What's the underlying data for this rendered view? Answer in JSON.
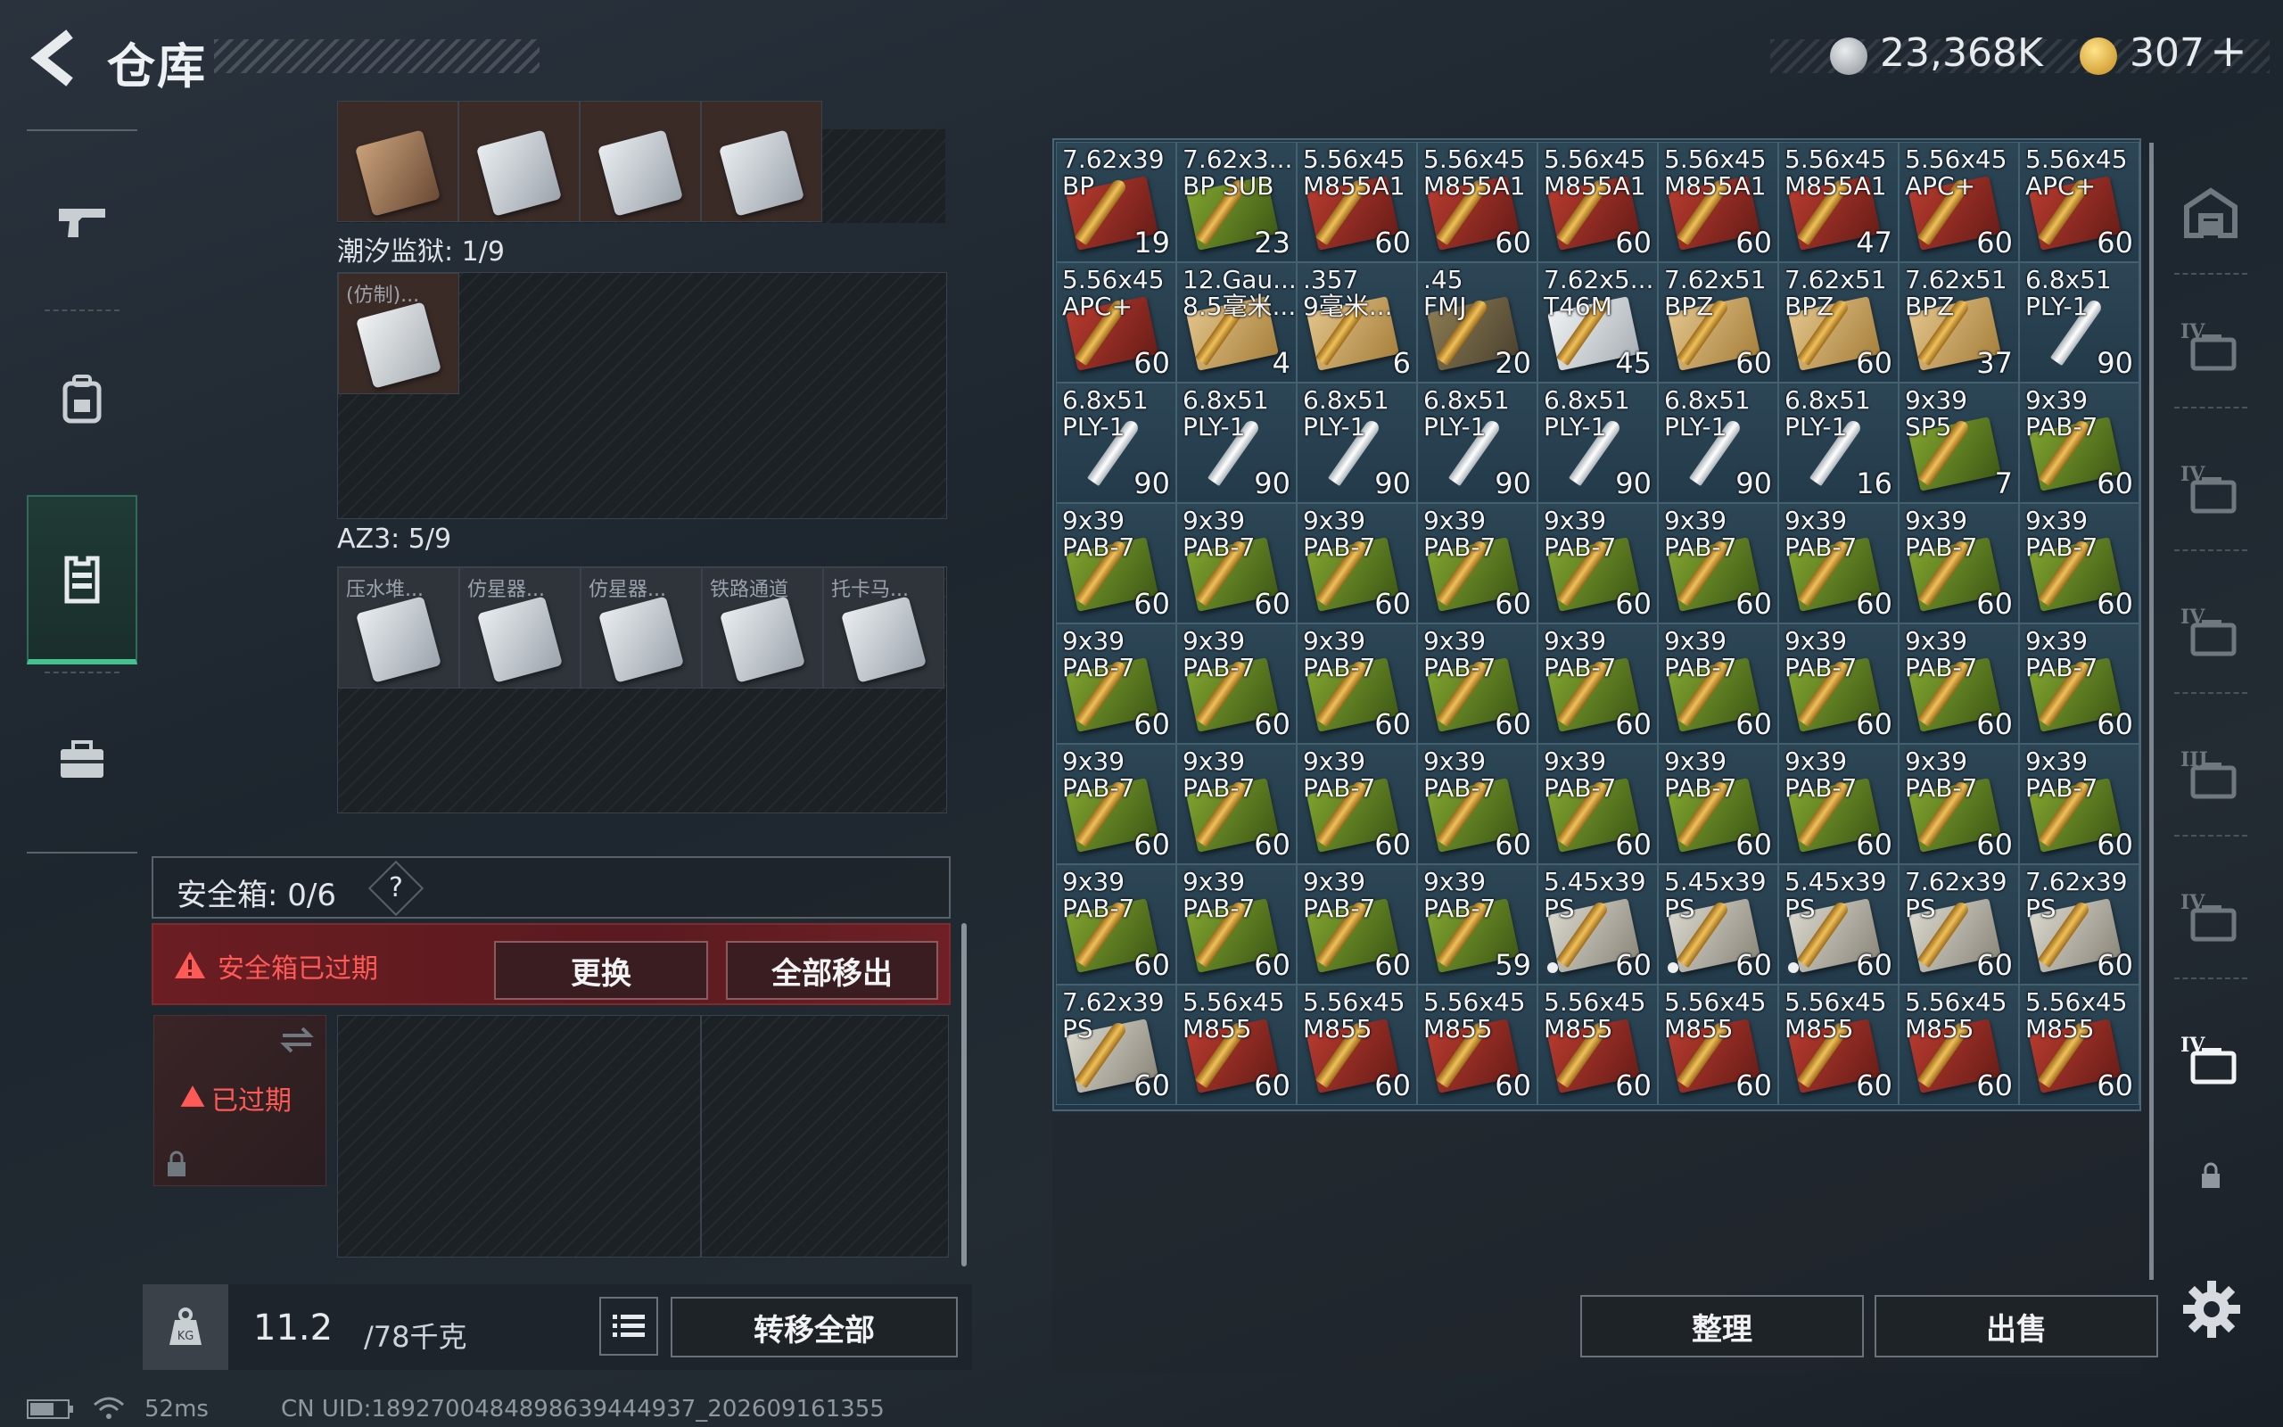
{
  "header": {
    "title": "仓库",
    "silver_amount": "23,368K",
    "gold_amount": "307",
    "plus_label": "+"
  },
  "left_nav": [
    "gun-icon",
    "backpack-icon",
    "armor-vest-icon",
    "toolbox-icon"
  ],
  "containers": [
    {
      "label": "潮汐监狱: 1/9",
      "items": [
        "(仿制)..."
      ]
    },
    {
      "label": "AZ3: 5/9",
      "items": [
        "压水堆...",
        "仿星器...",
        "仿星器...",
        "铁路通道",
        "托卡马..."
      ]
    }
  ],
  "safe_box": {
    "label": "安全箱: 0/6",
    "help": "?",
    "expired_text": "安全箱已过期",
    "replace_label": "更换",
    "move_all_label": "全部移出",
    "case_status": "已过期"
  },
  "footer": {
    "weight_current": "11.2",
    "weight_max": "/78千克",
    "transfer_label": "转移全部",
    "sort_label": "整理",
    "sell_label": "出售"
  },
  "stash": {
    "rows": [
      [
        {
          "name": "7.62x39\nBP",
          "count": "19",
          "kind": "red"
        },
        {
          "name": "7.62x3...\nBP SUB",
          "count": "23",
          "kind": "green"
        },
        {
          "name": "5.56x45\nM855A1",
          "count": "60",
          "kind": "red"
        },
        {
          "name": "5.56x45\nM855A1",
          "count": "60",
          "kind": "red"
        },
        {
          "name": "5.56x45\nM855A1",
          "count": "60",
          "kind": "red"
        },
        {
          "name": "5.56x45\nM855A1",
          "count": "60",
          "kind": "red"
        },
        {
          "name": "5.56x45\nM855A1",
          "count": "47",
          "kind": "red"
        },
        {
          "name": "5.56x45\nAPC+",
          "count": "60",
          "kind": "red"
        },
        {
          "name": "5.56x45\nAPC+",
          "count": "60",
          "kind": "red"
        }
      ],
      [
        {
          "name": "5.56x45\nAPC+",
          "count": "60",
          "kind": "red"
        },
        {
          "name": "12.Gau...\n8.5毫米...",
          "count": "4",
          "kind": "tan"
        },
        {
          "name": ".357\n9毫米...",
          "count": "6",
          "kind": "tan"
        },
        {
          "name": ".45\nFMJ",
          "count": "20",
          "kind": "olive"
        },
        {
          "name": "7.62x5...\nT46M",
          "count": "45",
          "kind": "white"
        },
        {
          "name": "7.62x51\nBPZ",
          "count": "60",
          "kind": "tan"
        },
        {
          "name": "7.62x51\nBPZ",
          "count": "60",
          "kind": "tan"
        },
        {
          "name": "7.62x51\nBPZ",
          "count": "37",
          "kind": "tan"
        },
        {
          "name": "6.8x51\nPLY-1",
          "count": "90",
          "kind": "none"
        }
      ],
      [
        {
          "name": "6.8x51\nPLY-1",
          "count": "90",
          "kind": "none"
        },
        {
          "name": "6.8x51\nPLY-1",
          "count": "90",
          "kind": "none"
        },
        {
          "name": "6.8x51\nPLY-1",
          "count": "90",
          "kind": "none"
        },
        {
          "name": "6.8x51\nPLY-1",
          "count": "90",
          "kind": "none"
        },
        {
          "name": "6.8x51\nPLY-1",
          "count": "90",
          "kind": "none"
        },
        {
          "name": "6.8x51\nPLY-1",
          "count": "90",
          "kind": "none"
        },
        {
          "name": "6.8x51\nPLY-1",
          "count": "16",
          "kind": "none"
        },
        {
          "name": "9x39\nSP5",
          "count": "7",
          "kind": "green"
        },
        {
          "name": "9x39\nPAB-7",
          "count": "60",
          "kind": "green"
        }
      ],
      [
        {
          "name": "9x39\nPAB-7",
          "count": "60",
          "kind": "green"
        },
        {
          "name": "9x39\nPAB-7",
          "count": "60",
          "kind": "green"
        },
        {
          "name": "9x39\nPAB-7",
          "count": "60",
          "kind": "green"
        },
        {
          "name": "9x39\nPAB-7",
          "count": "60",
          "kind": "green"
        },
        {
          "name": "9x39\nPAB-7",
          "count": "60",
          "kind": "green"
        },
        {
          "name": "9x39\nPAB-7",
          "count": "60",
          "kind": "green"
        },
        {
          "name": "9x39\nPAB-7",
          "count": "60",
          "kind": "green"
        },
        {
          "name": "9x39\nPAB-7",
          "count": "60",
          "kind": "green"
        },
        {
          "name": "9x39\nPAB-7",
          "count": "60",
          "kind": "green"
        }
      ],
      [
        {
          "name": "9x39\nPAB-7",
          "count": "60",
          "kind": "green"
        },
        {
          "name": "9x39\nPAB-7",
          "count": "60",
          "kind": "green"
        },
        {
          "name": "9x39\nPAB-7",
          "count": "60",
          "kind": "green"
        },
        {
          "name": "9x39\nPAB-7",
          "count": "60",
          "kind": "green"
        },
        {
          "name": "9x39\nPAB-7",
          "count": "60",
          "kind": "green"
        },
        {
          "name": "9x39\nPAB-7",
          "count": "60",
          "kind": "green"
        },
        {
          "name": "9x39\nPAB-7",
          "count": "60",
          "kind": "green"
        },
        {
          "name": "9x39\nPAB-7",
          "count": "60",
          "kind": "green"
        },
        {
          "name": "9x39\nPAB-7",
          "count": "60",
          "kind": "green"
        }
      ],
      [
        {
          "name": "9x39\nPAB-7",
          "count": "60",
          "kind": "green"
        },
        {
          "name": "9x39\nPAB-7",
          "count": "60",
          "kind": "green"
        },
        {
          "name": "9x39\nPAB-7",
          "count": "60",
          "kind": "green"
        },
        {
          "name": "9x39\nPAB-7",
          "count": "60",
          "kind": "green"
        },
        {
          "name": "9x39\nPAB-7",
          "count": "60",
          "kind": "green"
        },
        {
          "name": "9x39\nPAB-7",
          "count": "60",
          "kind": "green"
        },
        {
          "name": "9x39\nPAB-7",
          "count": "60",
          "kind": "green"
        },
        {
          "name": "9x39\nPAB-7",
          "count": "60",
          "kind": "green"
        },
        {
          "name": "9x39\nPAB-7",
          "count": "60",
          "kind": "green"
        }
      ],
      [
        {
          "name": "9x39\nPAB-7",
          "count": "60",
          "kind": "green"
        },
        {
          "name": "9x39\nPAB-7",
          "count": "60",
          "kind": "green"
        },
        {
          "name": "9x39\nPAB-7",
          "count": "60",
          "kind": "green"
        },
        {
          "name": "9x39\nPAB-7",
          "count": "59",
          "kind": "green"
        },
        {
          "name": "5.45x39\nPS",
          "count": "60",
          "kind": "grey",
          "dot": true
        },
        {
          "name": "5.45x39\nPS",
          "count": "60",
          "kind": "grey",
          "dot": true
        },
        {
          "name": "5.45x39\nPS",
          "count": "60",
          "kind": "grey",
          "dot": true
        },
        {
          "name": "7.62x39\nPS",
          "count": "60",
          "kind": "grey"
        },
        {
          "name": "7.62x39\nPS",
          "count": "60",
          "kind": "grey"
        }
      ],
      [
        {
          "name": "7.62x39\nPS",
          "count": "60",
          "kind": "grey"
        },
        {
          "name": "5.56x45\nM855",
          "count": "60",
          "kind": "red"
        },
        {
          "name": "5.56x45\nM855",
          "count": "60",
          "kind": "red"
        },
        {
          "name": "5.56x45\nM855",
          "count": "60",
          "kind": "red"
        },
        {
          "name": "5.56x45\nM855",
          "count": "60",
          "kind": "red"
        },
        {
          "name": "5.56x45\nM855",
          "count": "60",
          "kind": "red"
        },
        {
          "name": "5.56x45\nM855",
          "count": "60",
          "kind": "red"
        },
        {
          "name": "5.56x45\nM855",
          "count": "60",
          "kind": "red"
        },
        {
          "name": "5.56x45\nM855",
          "count": "60",
          "kind": "red"
        }
      ]
    ]
  },
  "right_nav": [
    {
      "icon": "home-stash-icon",
      "tier": ""
    },
    {
      "icon": "folder-icon",
      "tier": "IV"
    },
    {
      "icon": "medical-case-icon",
      "tier": "IV"
    },
    {
      "icon": "case-icon",
      "tier": "IV"
    },
    {
      "icon": "weapon-case-icon",
      "tier": "III"
    },
    {
      "icon": "folder-icon",
      "tier": "IV"
    },
    {
      "icon": "folder-active-icon",
      "tier": "IV"
    }
  ],
  "status": {
    "ping": "52ms",
    "uid": "CN UID:1892700484898639444937_202609161355"
  },
  "colors": {
    "accent_green": "#43c48e",
    "alert_red": "#ff5a55",
    "stash_bg": "#1f3747"
  }
}
